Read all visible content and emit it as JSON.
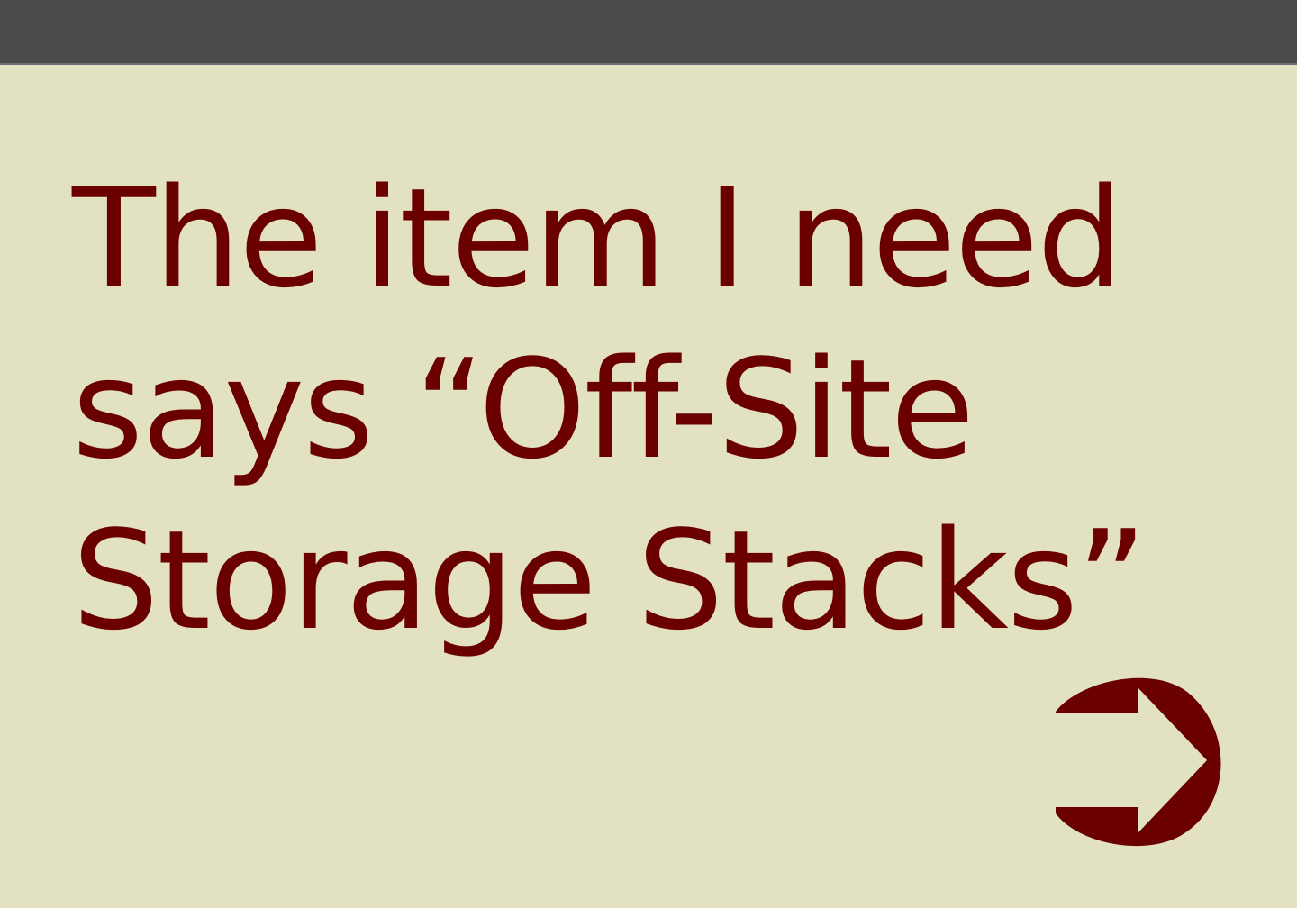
{
  "header": {
    "bar_color": "#4a4a4a"
  },
  "message": {
    "line1": "The item I need",
    "line2_prefix": "says ",
    "line2_quote": "“Off-Site",
    "line3": "Storage Stacks”"
  },
  "navigation": {
    "next_icon": "arrow-right-circle-icon"
  },
  "colors": {
    "background": "#e2e2c2",
    "text": "#6b0000",
    "accent": "#6b0000"
  }
}
